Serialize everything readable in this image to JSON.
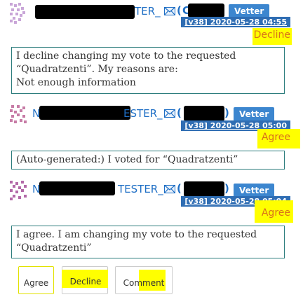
{
  "posts": [
    {
      "name_suffix": "TER_",
      "paren_open": "(",
      "paren_letter": "C",
      "role_badge": "Vetter",
      "timestamp": "[v38] 2020-05-28 04:55",
      "vote_label": "Decline",
      "body_lines": [
        "I decline changing my vote to the requested",
        "“Quadratzenti”. My reasons are:",
        "Not enough information"
      ]
    },
    {
      "name_prefix": "N",
      "name_suffix": "ESTER_",
      "paren_open": "(",
      "paren_close": ")",
      "role_badge": "Vetter",
      "timestamp": "[v38] 2020-05-28 05:00",
      "vote_label": "Agree",
      "body_lines": [
        "(Auto-generated:) I voted for “Quadratzenti”"
      ]
    },
    {
      "name_prefix": "N",
      "name_suffix": "TESTER_",
      "paren_open": "(",
      "paren_close": ")",
      "role_badge": "Vetter",
      "timestamp": "[v38] 2020-05-28 05:04",
      "vote_label": "Agree",
      "body_lines": [
        "I agree. I am changing my vote to the requested",
        "“Quadratzenti”"
      ]
    }
  ],
  "actions": {
    "agree_label": "Agree",
    "decline_label": "Decline",
    "comment_label": "Comment"
  },
  "icons": {
    "avatar": "identicon",
    "mail": "envelope-icon"
  },
  "colors": {
    "link": "#1f6fc5",
    "vetter_badge": "#3c86cf",
    "timestamp_badge": "#2f6db3",
    "vote_text": "#d8701b",
    "highlight": "#ffff00",
    "box_border": "#2d7d7d"
  }
}
